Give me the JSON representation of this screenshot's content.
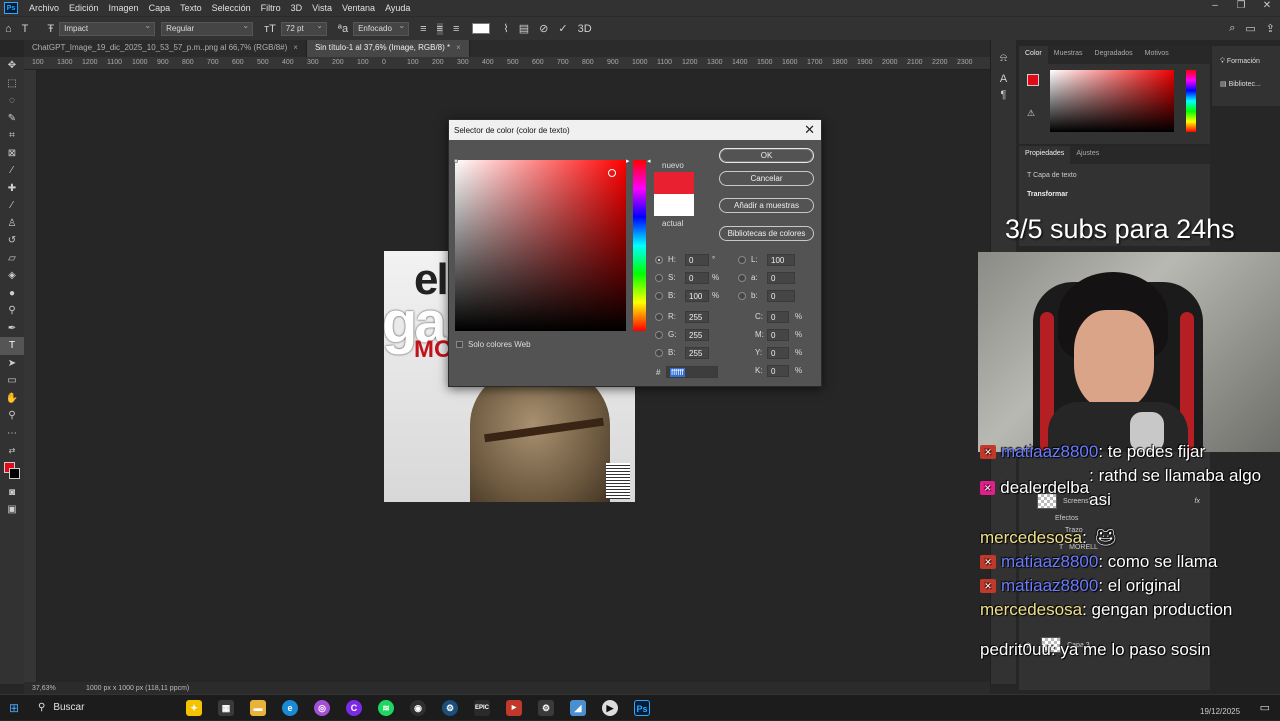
{
  "menu": {
    "app_logo": "Ps",
    "items": [
      "Archivo",
      "Edición",
      "Imagen",
      "Capa",
      "Texto",
      "Selección",
      "Filtro",
      "3D",
      "Vista",
      "Ventana",
      "Ayuda"
    ]
  },
  "options_bar": {
    "font_family": "Impact",
    "font_style": "Regular",
    "font_size": "72 pt",
    "antialias": "Enfocado"
  },
  "tabs": [
    {
      "label": "ChatGPT_Image_19_dic_2025_10_53_57_p.m..png al 66,7% (RGB/8#)",
      "close": "×"
    },
    {
      "label": "Sin título-1 al 37,6% (Image, RGB/8) *",
      "close": "×"
    }
  ],
  "ruler_labels": [
    "100",
    "1300",
    "1200",
    "1100",
    "1000",
    "900",
    "800",
    "700",
    "600",
    "500",
    "400",
    "300",
    "200",
    "100",
    "0",
    "100",
    "200",
    "300",
    "400",
    "500",
    "600",
    "700",
    "800",
    "900",
    "1000",
    "1100",
    "1200",
    "1300",
    "1400",
    "1500",
    "1600",
    "1700",
    "1800",
    "1900",
    "2000",
    "2100",
    "2200",
    "2300"
  ],
  "status_bar": {
    "zoom": "37,63%",
    "doc_info": "1000 px x 1000 px (118,11 ppcm)"
  },
  "color_panel": {
    "tabs": [
      "Color",
      "Muestras",
      "Degradados",
      "Motivos"
    ]
  },
  "properties_panel": {
    "tabs": [
      "Propiedades",
      "Ajustes"
    ],
    "layer_type": "Capa de texto",
    "section": "Transformar"
  },
  "far_right": {
    "items": [
      "Formación",
      "Bibliotec..."
    ]
  },
  "layers": [
    {
      "name": "Screenshot_61",
      "fx": "fx"
    },
    {
      "name": "Efectos"
    },
    {
      "name": "Trazo"
    },
    {
      "name": "MORELL"
    },
    {
      "name": "Capa 3"
    }
  ],
  "dialog": {
    "title": "Selector de color (color de texto)",
    "close": "✕",
    "new_label": "nuevo",
    "current_label": "actual",
    "new_color": "#e8202f",
    "current_color": "#ffffff",
    "buttons": {
      "ok": "OK",
      "cancel": "Cancelar",
      "add_swatch": "Añadir a muestras",
      "libraries": "Bibliotecas de colores"
    },
    "web_only": "Solo colores Web",
    "fields": {
      "H": "0",
      "H_unit": "°",
      "S": "0",
      "S_unit": "%",
      "Bv": "100",
      "Bv_unit": "%",
      "R": "255",
      "G": "255",
      "B": "255",
      "L": "100",
      "a": "0",
      "b": "0",
      "C": "0",
      "M": "0",
      "Y": "0",
      "K": "0",
      "pct": "%",
      "hex_label": "#",
      "hex": "ffffff"
    }
  },
  "stream": {
    "sub_goal": "3/5 subs para 24hs",
    "chat": [
      {
        "user": "matiaaz8800",
        "text": ": te podes fijar",
        "user_color": "#6a7cff"
      },
      {
        "user": "dealerdelba",
        "text": ": rathd se llamaba algo asi",
        "user_color": "#ffffff"
      },
      {
        "user": "mercedesosa",
        "text": ":",
        "user_color": "#f0e08a"
      },
      {
        "user": "matiaaz8800",
        "text": ": como se llama",
        "user_color": "#6a7cff"
      },
      {
        "user": "matiaaz8800",
        "text": ": el original",
        "user_color": "#6a7cff"
      },
      {
        "user": "mercedesosa",
        "text": ": gengan production",
        "user_color": "#f0e08a"
      },
      {
        "user": "pedrit0uu",
        "text": ": ya me lo paso sosin",
        "user_color": "#ffffff"
      }
    ]
  },
  "canvas_text": {
    "line1": "el",
    "line2": "ga",
    "line3": "MO"
  },
  "taskbar": {
    "search": "Buscar",
    "date": "19/12/2025"
  }
}
